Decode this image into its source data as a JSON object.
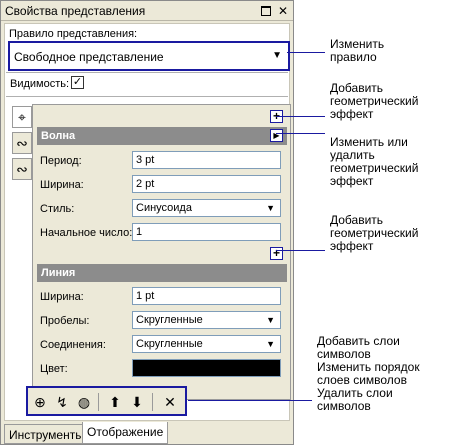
{
  "window": {
    "title": "Свойства представления",
    "restore_icon": "restore-icon",
    "close_icon": "close-icon",
    "close_glyph": "✕"
  },
  "rule": {
    "label": "Правило представления:",
    "value": "Свободное представление",
    "arrow": "▼"
  },
  "visibility": {
    "label": "Видимость:",
    "checked": true,
    "check_glyph": "✓"
  },
  "side_tabs": [
    {
      "icon": "marker-layer-icon",
      "glyph": "⌖"
    },
    {
      "icon": "stroke-layer-icon",
      "glyph": "∾"
    },
    {
      "icon": "stroke-layer-icon-2",
      "glyph": "∾"
    }
  ],
  "wave": {
    "header": "Волна",
    "add_glyph": "+",
    "menu_glyph": "▶",
    "period_label": "Период:",
    "period_value": "3 pt",
    "width_label": "Ширина:",
    "width_value": "2 pt",
    "style_label": "Стиль:",
    "style_value": "Синусоида",
    "start_label": "Начальное число:",
    "start_value": "1"
  },
  "line": {
    "add_glyph": "+",
    "header": "Линия",
    "width_label": "Ширина:",
    "width_value": "1 pt",
    "caps_label": "Пробелы:",
    "caps_value": "Скругленные",
    "joins_label": "Соединения:",
    "joins_value": "Скругленные",
    "color_label": "Цвет:",
    "color_value": "#000000"
  },
  "layer_toolbar": {
    "add_layer_glyph": "⊕",
    "add_stroke_glyph": "↯",
    "add_fill_glyph": "◍",
    "up_glyph": "⬆",
    "down_glyph": "⬇",
    "delete_glyph": "✕"
  },
  "tabs": {
    "tools": "Инструменты",
    "display": "Отображение"
  },
  "callouts": {
    "change_rule": "Изменить\nправило",
    "add_effect_1": "Добавить\nгеометрический\nэффект",
    "change_or_delete": "Изменить или\nудалить\nгеометрический\nэффект",
    "add_effect_2": "Добавить\nгеометрический\nэффект",
    "layer_ops": "Добавить слои\nсимволов\nИзменить порядок\nслоев символов\nУдалить слои\nсимволов"
  },
  "colors": {
    "accent": "#1a1aa0",
    "header_bg": "#8c8c8c",
    "panel_bg": "#ece9d8"
  }
}
